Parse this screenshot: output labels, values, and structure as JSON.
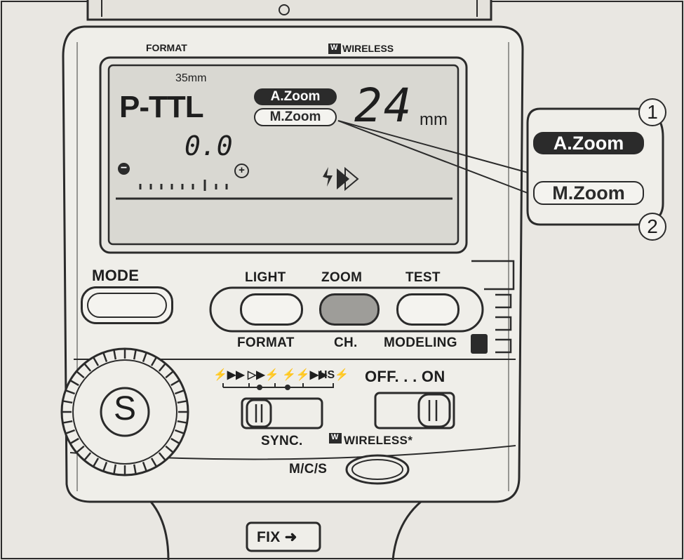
{
  "panel": {
    "format_top": "FORMAT",
    "wireless_top": "WIRELESS",
    "mode_label": "MODE",
    "light_label": "LIGHT",
    "zoom_label": "ZOOM",
    "test_label": "TEST",
    "format_bottom": "FORMAT",
    "ch_label": "CH.",
    "modeling_label": "MODELING",
    "off_on_label": "OFF. . . ON",
    "sync_label": "SYNC.",
    "wireless_bottom": "WIRELESS",
    "mcs_label": "M/C/S",
    "fix_label": "FIX",
    "dial_letter": "S",
    "hs_label": "HS"
  },
  "lcd": {
    "format_size": "35mm",
    "mode": "P-TTL",
    "compensation": "0.0",
    "a_zoom": "A.Zoom",
    "m_zoom": "M.Zoom",
    "zoom_value": "24",
    "zoom_unit": "mm",
    "minus": "−",
    "plus": "+"
  },
  "callout": {
    "a_zoom": "A.Zoom",
    "m_zoom": "M.Zoom",
    "num1": "1",
    "num2": "2"
  }
}
